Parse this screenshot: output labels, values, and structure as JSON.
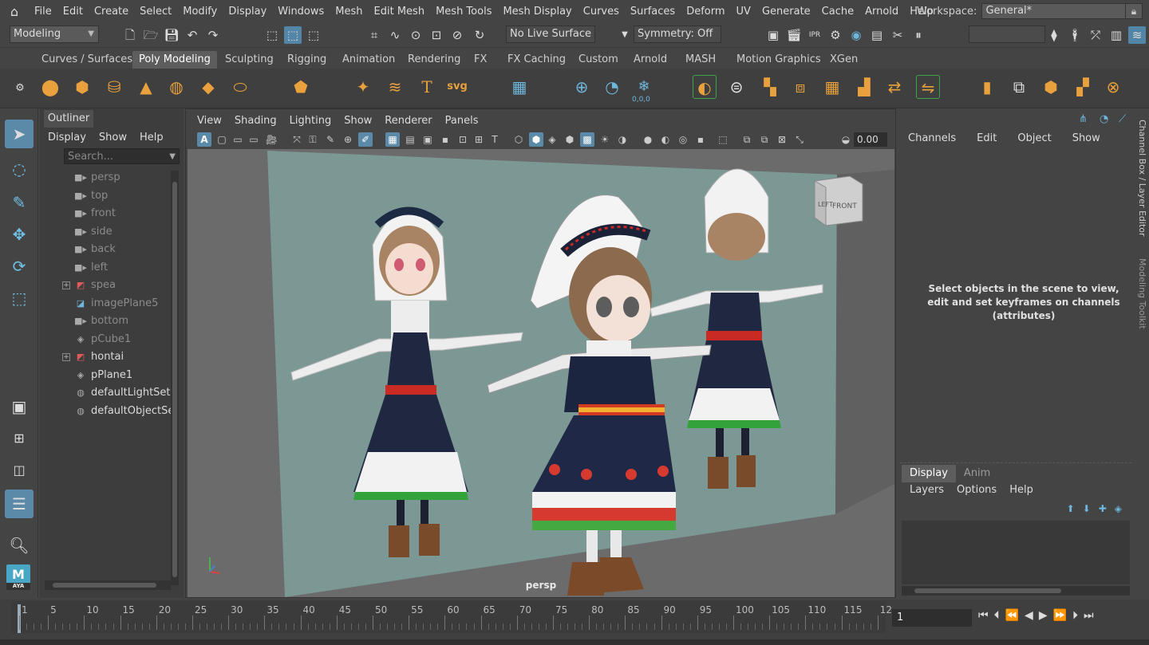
{
  "menubar": {
    "items": [
      "File",
      "Edit",
      "Create",
      "Select",
      "Modify",
      "Display",
      "Windows",
      "Mesh",
      "Edit Mesh",
      "Mesh Tools",
      "Mesh Display",
      "Curves",
      "Surfaces",
      "Deform",
      "UV",
      "Generate",
      "Cache",
      "Arnold",
      "Help"
    ],
    "workspace_label": "Workspace:",
    "workspace_value": "General*"
  },
  "statusline": {
    "mode": "Modeling",
    "live_surface": "No Live Surface",
    "symmetry": "Symmetry: Off"
  },
  "shelf": {
    "tabs": [
      "Curves / Surfaces",
      "Poly Modeling",
      "Sculpting",
      "Rigging",
      "Animation",
      "Rendering",
      "FX",
      "FX Caching",
      "Custom",
      "Arnold",
      "MASH",
      "Motion Graphics",
      "XGen"
    ],
    "selected_tab": "Poly Modeling",
    "svg_label": "svg",
    "text_label": "T",
    "counter": "0,0,0"
  },
  "outliner": {
    "title": "Outliner",
    "menu": [
      "Display",
      "Show",
      "Help"
    ],
    "search_placeholder": "Search...",
    "items": [
      {
        "label": "persp",
        "icon": "camera-icon",
        "expandable": false,
        "lit": false
      },
      {
        "label": "top",
        "icon": "camera-icon",
        "expandable": false,
        "lit": false
      },
      {
        "label": "front",
        "icon": "camera-icon",
        "expandable": false,
        "lit": false
      },
      {
        "label": "side",
        "icon": "camera-icon",
        "expandable": false,
        "lit": false
      },
      {
        "label": "back",
        "icon": "camera-icon",
        "expandable": false,
        "lit": false
      },
      {
        "label": "left",
        "icon": "camera-icon",
        "expandable": false,
        "lit": false
      },
      {
        "label": "spea",
        "icon": "mesh-group-icon",
        "expandable": true,
        "lit": false
      },
      {
        "label": "imagePlane5",
        "icon": "image-plane-icon",
        "expandable": false,
        "lit": false
      },
      {
        "label": "bottom",
        "icon": "camera-icon",
        "expandable": false,
        "lit": false
      },
      {
        "label": "pCube1",
        "icon": "mesh-icon",
        "expandable": false,
        "lit": false
      },
      {
        "label": "hontai",
        "icon": "mesh-group-icon",
        "expandable": true,
        "lit": true
      },
      {
        "label": "pPlane1",
        "icon": "mesh-icon",
        "expandable": false,
        "lit": true
      },
      {
        "label": "defaultLightSet",
        "icon": "set-icon",
        "expandable": false,
        "lit": true
      },
      {
        "label": "defaultObjectSet",
        "icon": "set-icon",
        "expandable": false,
        "lit": true
      }
    ]
  },
  "viewport": {
    "menu": [
      "View",
      "Shading",
      "Lighting",
      "Show",
      "Renderer",
      "Panels"
    ],
    "field_value": "0.00",
    "camera_label": "persp",
    "cube_left": "LEFT",
    "cube_front": "FRONT"
  },
  "channelbox": {
    "menu": [
      "Channels",
      "Edit",
      "Object",
      "Show"
    ],
    "message_line1": "Select objects in the scene to view,",
    "message_line2": "edit and set keyframes on channels",
    "message_line3": "(attributes)"
  },
  "side_tabs": {
    "channel_box": "Channel Box / Layer Editor",
    "modeling_toolkit": "Modeling Toolkit"
  },
  "layer_editor": {
    "tabs": [
      "Display",
      "Anim"
    ],
    "menu": [
      "Layers",
      "Options",
      "Help"
    ]
  },
  "timeline": {
    "labels": [
      "1",
      "5",
      "10",
      "15",
      "20",
      "25",
      "30",
      "35",
      "40",
      "45",
      "50",
      "55",
      "60",
      "65",
      "70",
      "75",
      "80",
      "85",
      "90",
      "95",
      "100",
      "105",
      "110",
      "115",
      "12"
    ],
    "current_frame": "1"
  },
  "logo": {
    "text": "M",
    "sub": "AYA"
  },
  "colors": {
    "accent": "#5b89a8",
    "shelf_orange": "#e8a13c",
    "background": "#444444",
    "viewport_bg": "#6b6b6b",
    "plane": "#7c9894"
  }
}
